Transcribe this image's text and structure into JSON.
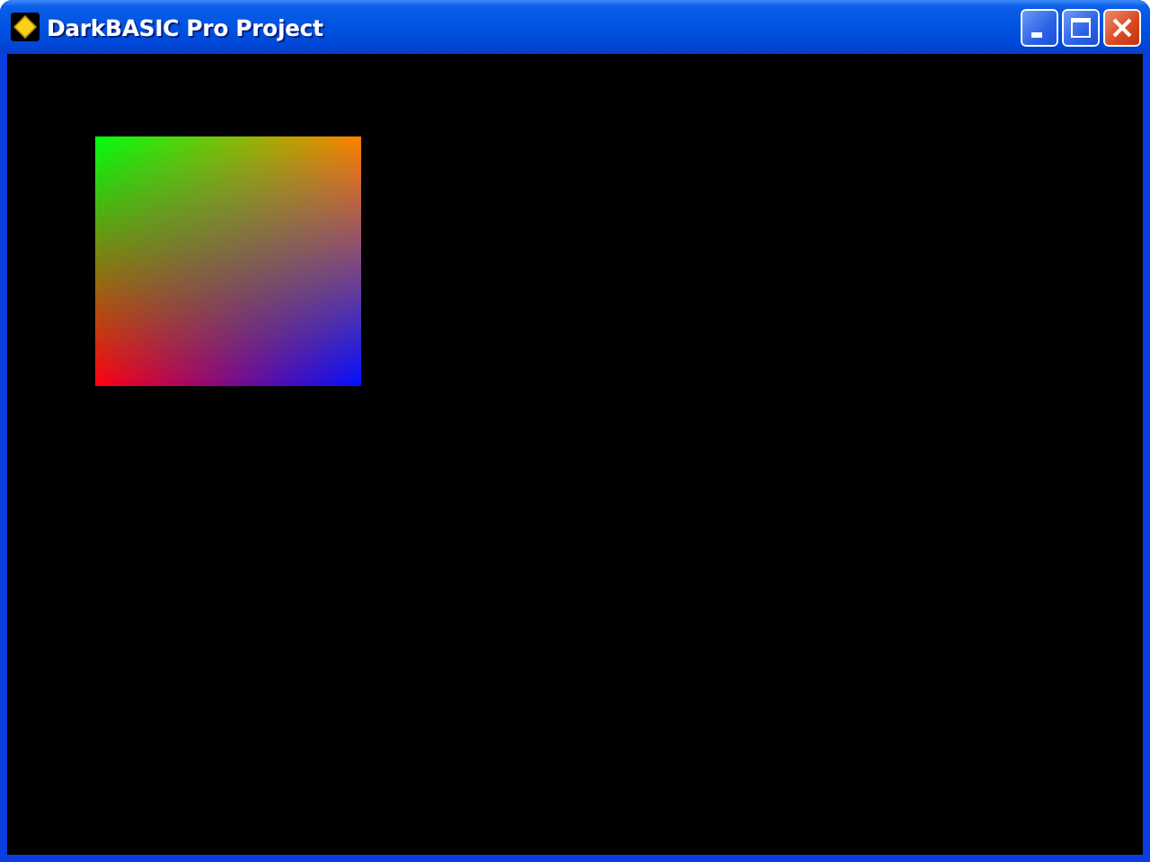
{
  "window": {
    "title": "DarkBASIC Pro Project"
  }
}
